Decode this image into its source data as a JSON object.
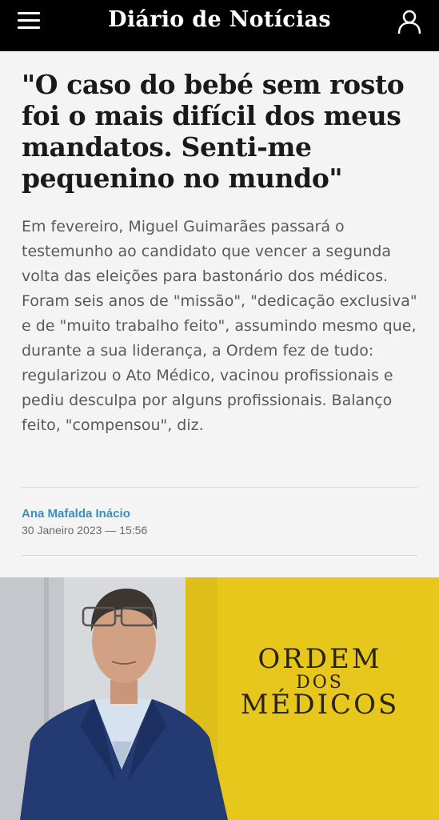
{
  "header": {
    "brand": "Diário de Notícias",
    "menu_icon": "hamburger-menu-icon",
    "user_icon": "user-account-icon",
    "background": "#000000"
  },
  "article": {
    "headline": "\"O caso do bebé sem rosto foi o mais difícil dos meus mandatos. Senti-me pequenino no mundo\"",
    "lead": "Em fevereiro, Miguel Guimarães passará o testemunho ao candidato que vencer a segunda volta das eleições para bastonário dos médicos. Foram seis anos de \"missão\", \"dedicação exclusiva\" e de \"muito trabalho feito\", assumindo mesmo que, durante a sua liderança, a Ordem fez de tudo: regularizou o Ato Médico, vacinou profissionais e pediu desculpa por alguns profissionais. Balanço feito, \"compensou\", diz.",
    "author": "Ana Mafalda Inácio",
    "date": "30 Janeiro 2023 — 15:56",
    "author_color": "#3a8fc0"
  },
  "photo": {
    "sign_line1": "ORDEM",
    "sign_line2": "DOS",
    "sign_line3": "MÉDICOS",
    "wall_color": "#e7c71c"
  }
}
